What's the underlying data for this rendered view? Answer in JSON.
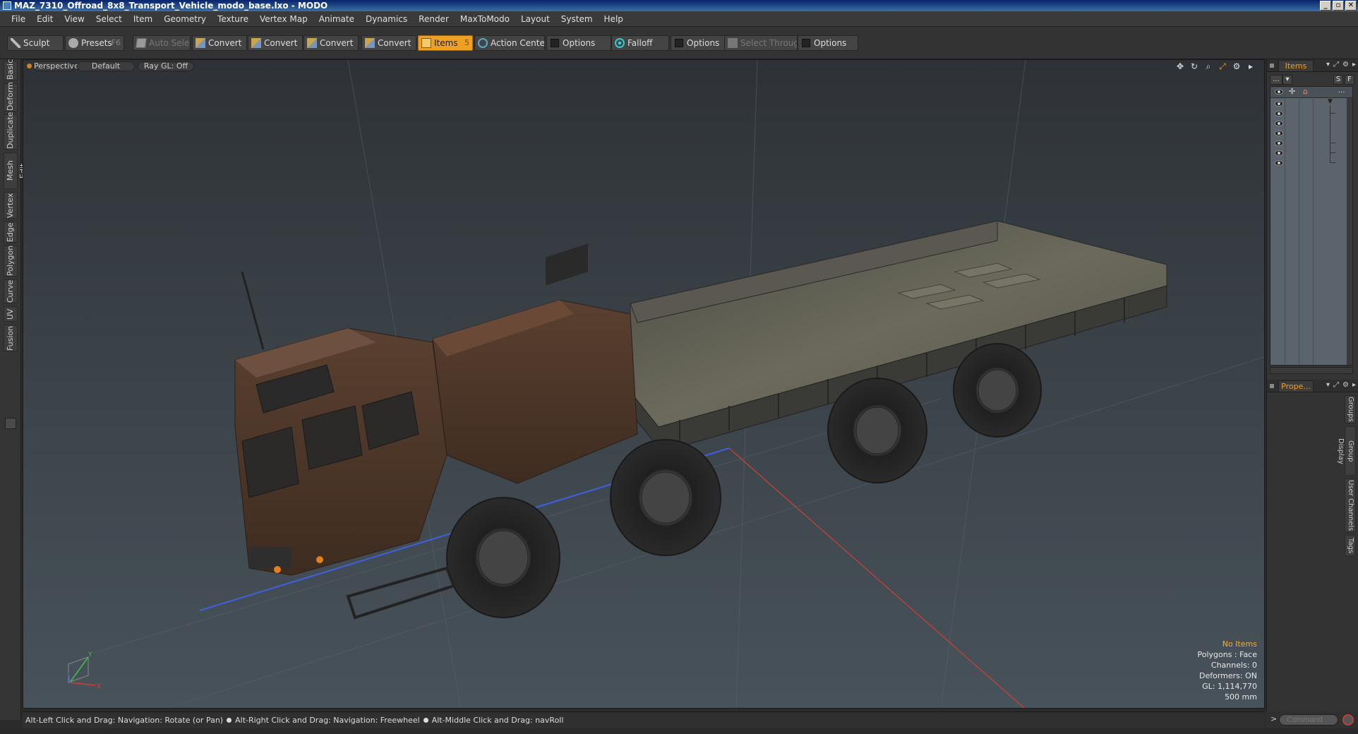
{
  "window": {
    "title": "MAZ_7310_Offroad_8x8_Transport_Vehicle_modo_base.lxo - MODO",
    "controls": [
      "_",
      "▫",
      "✕"
    ]
  },
  "menu": [
    "File",
    "Edit",
    "View",
    "Select",
    "Item",
    "Geometry",
    "Texture",
    "Vertex Map",
    "Animate",
    "Dynamics",
    "Render",
    "MaxToModo",
    "Layout",
    "System",
    "Help"
  ],
  "toolbar": {
    "sculpt": "Sculpt",
    "presets": "Presets",
    "presets_shortcut": "F6",
    "auto_select": "Auto Select",
    "convert1": "Convert",
    "convert2": "Convert",
    "convert3": "Convert",
    "convert4": "Convert",
    "items": "Items",
    "items_shortcut": "5",
    "action_center": "Action Center",
    "options1": "Options",
    "falloff": "Falloff",
    "options2": "Options",
    "select_through": "Select Through",
    "options3": "Options"
  },
  "left_tabs": [
    "Basic",
    "Deform",
    "Duplicate",
    "Mesh Edit",
    "Vertex",
    "Edge",
    "Polygon",
    "Curve",
    "UV",
    "Fusion"
  ],
  "viewport": {
    "view": "Perspective",
    "shading": "Default",
    "raygl": "Ray GL: Off",
    "hud": {
      "title": "No Items",
      "polygons": "Polygons : Face",
      "channels": "Channels: 0",
      "deformers": "Deformers: ON",
      "gl": "GL: 1,114,770",
      "scale": "500 mm"
    },
    "axis_labels": {
      "y": "Y",
      "x": "X"
    }
  },
  "status": {
    "hint1": "Alt-Left Click and Drag: Navigation: Rotate (or Pan)",
    "hint2": "Alt-Right Click and Drag: Navigation: Freewheel",
    "hint3": "Alt-Middle Click and Drag: navRoll"
  },
  "right_panel": {
    "items_tab": "Items",
    "items_menu": "...",
    "btn_s": "S",
    "btn_f": "F",
    "header_more": "...",
    "props_tab": "Prope...",
    "side_tabs": [
      "Groups",
      "Group Display",
      "User Channels",
      "Tags"
    ],
    "item_rows": 7
  },
  "command": {
    "placeholder": "Command",
    "arrow": ">"
  },
  "colors": {
    "accent": "#f0a020",
    "hud_title": "#f0b030",
    "axis_x": "#d04030",
    "axis_y": "#40c040",
    "axis_z": "#4060e0"
  }
}
